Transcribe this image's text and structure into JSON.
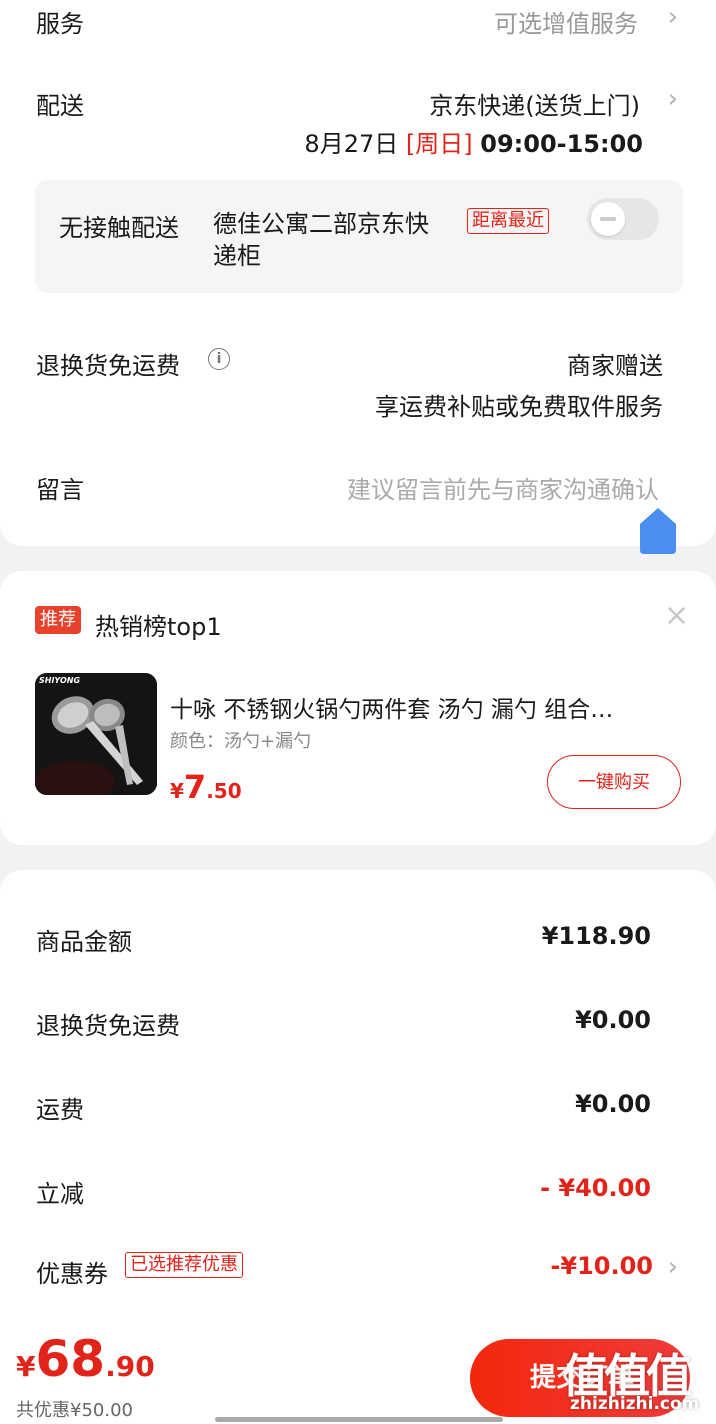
{
  "service": {
    "label": "服务",
    "value": "可选增值服务"
  },
  "delivery": {
    "label": "配送",
    "method": "京东快递(送货上门)",
    "date": "8月27日",
    "weekday": "[周日]",
    "time": "09:00-15:00"
  },
  "contactless": {
    "label": "无接触配送",
    "address": "德佳公寓二部京东快递柜",
    "tag": "距离最近"
  },
  "return_shipping": {
    "label": "退换货免运费",
    "value": "商家赠送",
    "desc": "享运费补贴或免费取件服务"
  },
  "message": {
    "label": "留言",
    "placeholder": "建议留言前先与商家沟通确认"
  },
  "recommend": {
    "badge": "推荐",
    "title": "热销榜top1",
    "close": "×",
    "product": {
      "brand_on_image": "SHIYONG",
      "name": "十咏 不锈钢火锅勺两件套  汤勺 漏勺 组合…",
      "spec": "颜色：汤勺+漏勺",
      "price_symbol": "¥",
      "price_int": "7",
      "price_dec": ".50",
      "buy_label": "一键购买"
    }
  },
  "summary": {
    "rows": [
      {
        "label": "商品金额",
        "value": "¥118.90"
      },
      {
        "label": "退换货免运费",
        "value": "¥0.00"
      },
      {
        "label": "运费",
        "value": "¥0.00"
      },
      {
        "label": "立减",
        "value": "- ¥40.00"
      },
      {
        "label": "优惠券",
        "tag": "已选推荐优惠",
        "value": "-¥10.00"
      }
    ]
  },
  "footer": {
    "price_symbol": "¥",
    "price_int": "68",
    "price_dec": ".90",
    "discount": "共优惠¥50.00",
    "submit_label": "提交订单"
  },
  "watermark": {
    "mark": "值",
    "site": "zhizhizhi.com"
  },
  "colors": {
    "accent": "#e2231a",
    "background": "#f2f2f2",
    "link_blue": "#4a8ff0"
  }
}
